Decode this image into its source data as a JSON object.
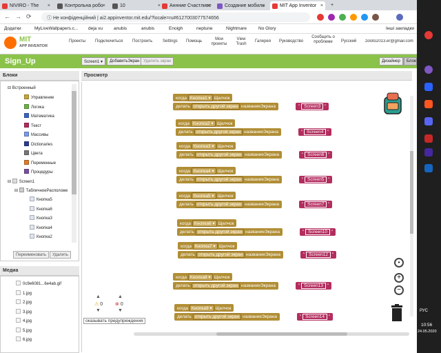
{
  "tabs": [
    {
      "title": "NIVIRO - The",
      "color": "#e53935"
    },
    {
      "title": "Контрольна робо",
      "color": "#555"
    },
    {
      "title": "10",
      "color": "#555"
    },
    {
      "title": "Аннние Счастливе",
      "color": "#e53935"
    },
    {
      "title": "Создание мобиль",
      "color": "#7e57c2"
    },
    {
      "title": "MIT App Inventor",
      "color": "#e53935"
    }
  ],
  "address": {
    "security": "Не конфіденційний",
    "url": "ai2.appinventor.mit.edu/?locale=ru#6127003077574656"
  },
  "bookmarks": [
    "Додатки",
    "MyLiveWallpapers.c...",
    "deja vu",
    "anubis",
    "anubis",
    "Enoigh",
    "neptune",
    "Nightmare",
    "No Glory",
    "Інші закладки"
  ],
  "logo": {
    "line1": "MIT",
    "line2": "APP INVENTOR"
  },
  "menus": [
    "Проекты",
    "Подключиться",
    "Построить",
    "Settings",
    "Помощь",
    "Мои проекты",
    "View Trash",
    "Галерея",
    "Руководство",
    "Сообщить о проблеме",
    "Русский",
    "zoloto2013.er@gmail.com"
  ],
  "project": {
    "name": "Sign_Up",
    "screen": "Screen1",
    "add_screen": "ДобавитьЭкран",
    "remove_screen": "Удалить экран",
    "designer": "Дизайнер",
    "blocks": "Блоки"
  },
  "blocks_panel": {
    "title": "Блоки",
    "builtin": "Встроенный",
    "items": [
      {
        "label": "Управление",
        "color": "#c8a53a"
      },
      {
        "label": "Логика",
        "color": "#6fb04a"
      },
      {
        "label": "Математика",
        "color": "#3b65c4"
      },
      {
        "label": "Текст",
        "color": "#b32d5e"
      },
      {
        "label": "Массивы",
        "color": "#7a9be8"
      },
      {
        "label": "Dictionaries",
        "color": "#2d3d8e"
      },
      {
        "label": "Цвета",
        "color": "#777"
      },
      {
        "label": "Переменные",
        "color": "#e07c2b"
      },
      {
        "label": "Процедуры",
        "color": "#7a4fa0"
      }
    ],
    "screen": "Screen1",
    "layout": "ТабличноеРасположе",
    "components": [
      "Кнопка5",
      "Кнопка6",
      "Кнопка3",
      "Кнопка4",
      "Кнопка2"
    ],
    "rename": "Переименовать",
    "delete": "Удалить"
  },
  "media": {
    "title": "Медиа",
    "files": [
      "0c9e6081...6e4ab.gif",
      "1.jpg",
      "2.jpg",
      "3.jpg",
      "4.jpg",
      "5.jpg",
      "6.jpg"
    ]
  },
  "viewer": {
    "title": "Просмотр",
    "warnings": {
      "count_warn": "0",
      "count_err": "0",
      "label": "оказывать предупреждения"
    }
  },
  "block_text": {
    "when": "когда",
    "event": "Щелчок",
    "do": "делать",
    "open": "открыть другой экран",
    "screen_name": "названиеЭкрана"
  },
  "event_blocks": [
    {
      "button": "Кнопка1",
      "target": "Screen3"
    },
    {
      "button": "Кнопка2",
      "target": "Screen4"
    },
    {
      "button": "Кнопка3",
      "target": "Screen6"
    },
    {
      "button": "Кнопка4",
      "target": "Screen5"
    },
    {
      "button": "Кнопка5",
      "target": "Screen7"
    },
    {
      "button": "Кнопка6",
      "target": "Screen10"
    },
    {
      "button": "Кнопка7",
      "target": "Screen12"
    },
    {
      "button": "Кнопка8",
      "target": "Screen13"
    },
    {
      "button": "Кнопка9",
      "target": "Screen14"
    }
  ],
  "taskbar": {
    "lang": "РУС",
    "time": "10:56",
    "date": "24.05.2020"
  }
}
